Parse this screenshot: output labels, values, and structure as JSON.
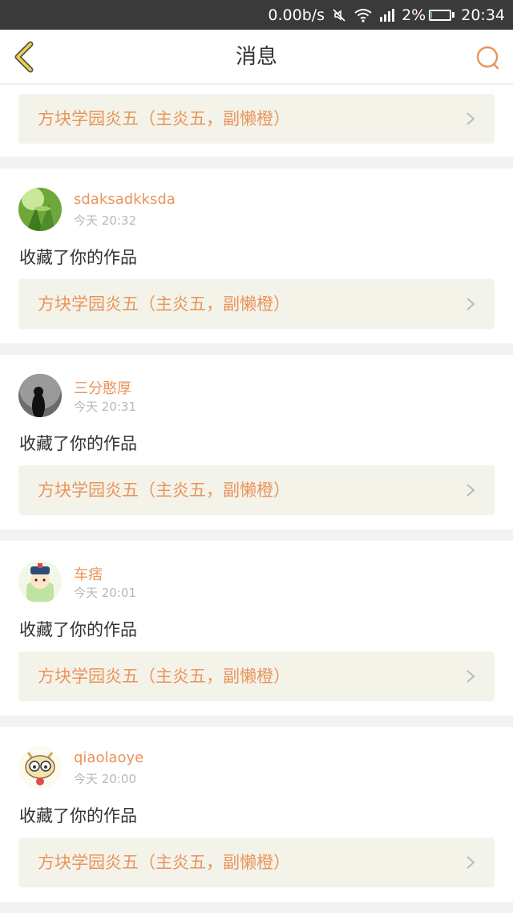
{
  "status_bar": {
    "speed": "0.00b/s",
    "battery": "2%",
    "battery_level": 0.02,
    "time": "20:34",
    "icons": [
      "mute-icon",
      "wifi-icon",
      "signal-icon",
      "battery-icon"
    ]
  },
  "nav": {
    "title": "消息",
    "back_icon": "chevron-left-icon",
    "search_icon": "search-icon",
    "accent": "#e8945a"
  },
  "colors": {
    "name": "#e8945a",
    "ref_text": "#e8945a",
    "ref_bg": "#f4f3ea",
    "time": "#b8b8b8"
  },
  "top_ref": {
    "text": "方块学园炎五（主炎五，副懒橙）"
  },
  "messages": [
    {
      "name": "sdaksadkksda",
      "time": "今天 20:32",
      "action": "收藏了你的作品",
      "ref": "方块学园炎五（主炎五，副懒橙）"
    },
    {
      "name": "三分憨厚",
      "time": "今天 20:31",
      "action": "收藏了你的作品",
      "ref": "方块学园炎五（主炎五，副懒橙）"
    },
    {
      "name": "车痞",
      "time": "今天 20:01",
      "action": "收藏了你的作品",
      "ref": "方块学园炎五（主炎五，副懒橙）"
    },
    {
      "name": "qiaolaoye",
      "time": "今天 20:00",
      "action": "收藏了你的作品",
      "ref": "方块学园炎五（主炎五，副懒橙）"
    }
  ]
}
